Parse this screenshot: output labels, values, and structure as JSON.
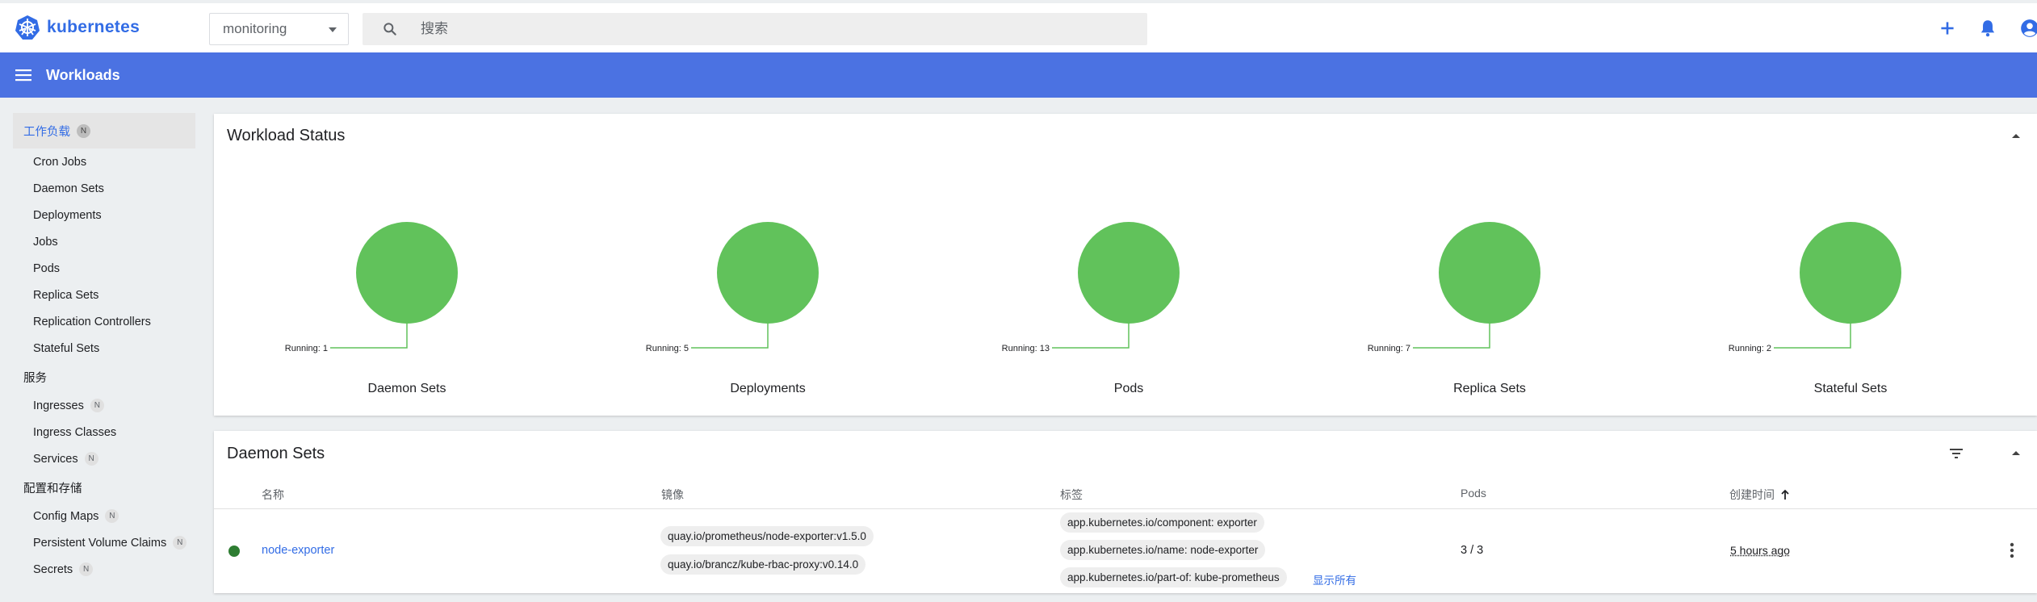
{
  "brand": {
    "name": "kubernetes"
  },
  "namespace": {
    "selected": "monitoring"
  },
  "search": {
    "placeholder": "搜索"
  },
  "header": {
    "title": "Workloads"
  },
  "sidebar": {
    "workloads_section": {
      "label": "工作负载",
      "badge": "N"
    },
    "workload_items": [
      {
        "label": "Cron Jobs"
      },
      {
        "label": "Daemon Sets"
      },
      {
        "label": "Deployments"
      },
      {
        "label": "Jobs"
      },
      {
        "label": "Pods"
      },
      {
        "label": "Replica Sets"
      },
      {
        "label": "Replication Controllers"
      },
      {
        "label": "Stateful Sets"
      }
    ],
    "services_group": {
      "label": "服务"
    },
    "service_items": [
      {
        "label": "Ingresses",
        "badge": "N"
      },
      {
        "label": "Ingress Classes"
      },
      {
        "label": "Services",
        "badge": "N"
      }
    ],
    "config_group": {
      "label": "配置和存储"
    },
    "config_items": [
      {
        "label": "Config Maps",
        "badge": "N"
      },
      {
        "label": "Persistent Volume Claims",
        "badge": "N"
      },
      {
        "label": "Secrets",
        "badge": "N"
      }
    ]
  },
  "workload_status": {
    "title": "Workload Status",
    "charts": [
      {
        "name": "Daemon Sets",
        "running_label": "Running: 1",
        "running": 1
      },
      {
        "name": "Deployments",
        "running_label": "Running: 5",
        "running": 5
      },
      {
        "name": "Pods",
        "running_label": "Running: 13",
        "running": 13
      },
      {
        "name": "Replica Sets",
        "running_label": "Running: 7",
        "running": 7
      },
      {
        "name": "Stateful Sets",
        "running_label": "Running: 2",
        "running": 2
      }
    ],
    "running_color": "#61c25b"
  },
  "chart_data": [
    {
      "type": "pie",
      "title": "Daemon Sets",
      "categories": [
        "Running"
      ],
      "values": [
        1
      ]
    },
    {
      "type": "pie",
      "title": "Deployments",
      "categories": [
        "Running"
      ],
      "values": [
        5
      ]
    },
    {
      "type": "pie",
      "title": "Pods",
      "categories": [
        "Running"
      ],
      "values": [
        13
      ]
    },
    {
      "type": "pie",
      "title": "Replica Sets",
      "categories": [
        "Running"
      ],
      "values": [
        7
      ]
    },
    {
      "type": "pie",
      "title": "Stateful Sets",
      "categories": [
        "Running"
      ],
      "values": [
        2
      ]
    }
  ],
  "daemon_sets": {
    "title": "Daemon Sets",
    "columns": {
      "name": "名称",
      "images": "镜像",
      "labels": "标签",
      "pods": "Pods",
      "created": "创建时间"
    },
    "rows": [
      {
        "name": "node-exporter",
        "images": [
          "quay.io/prometheus/node-exporter:v1.5.0",
          "quay.io/brancz/kube-rbac-proxy:v0.14.0"
        ],
        "labels": [
          "app.kubernetes.io/component: exporter",
          "app.kubernetes.io/name: node-exporter",
          "app.kubernetes.io/part-of: kube-prometheus"
        ],
        "show_all": "显示所有",
        "pods": "3 / 3",
        "created": "5 hours ago",
        "status_color": "#2e7d32"
      }
    ]
  },
  "colors": {
    "accent": "#326ce5",
    "header": "#4b72e2"
  }
}
